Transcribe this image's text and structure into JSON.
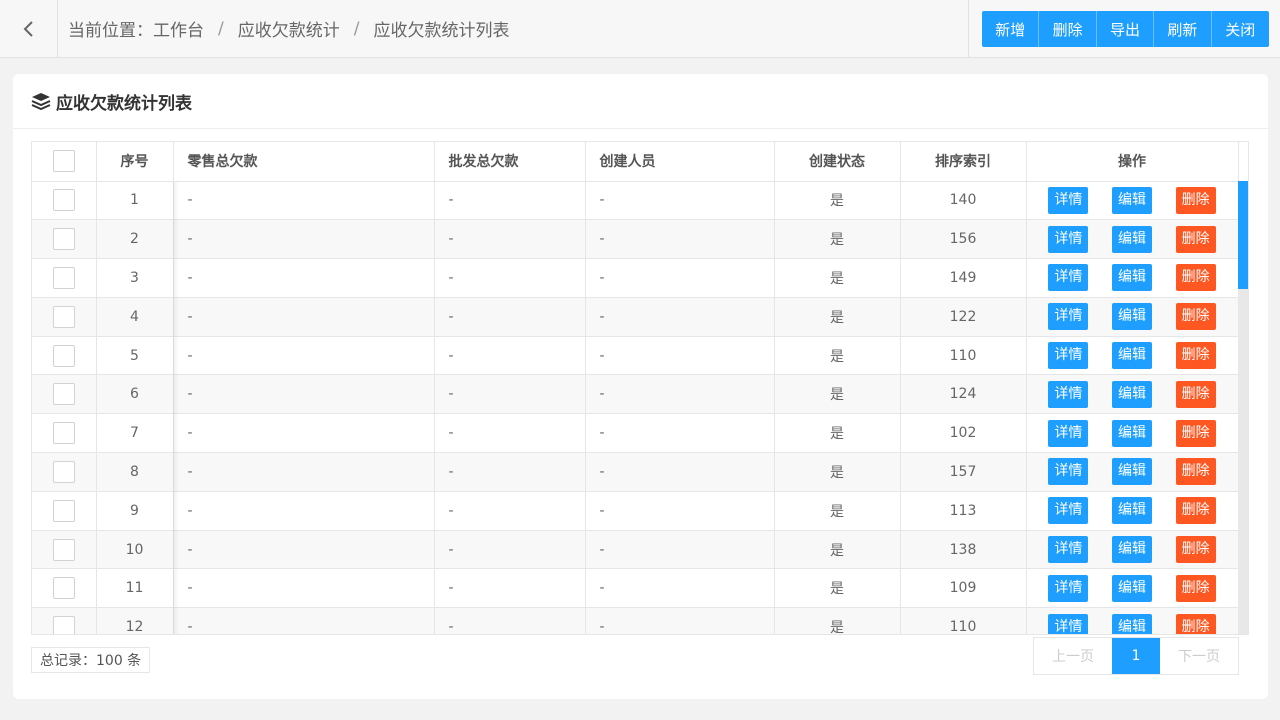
{
  "breadcrumb": {
    "prefix": "当前位置：",
    "items": [
      "工作台",
      "应收欠款统计",
      "应收欠款统计列表"
    ],
    "separator": "/"
  },
  "toolbar": {
    "add_label": "新增",
    "delete_label": "删除",
    "export_label": "导出",
    "refresh_label": "刷新",
    "close_label": "关闭"
  },
  "card": {
    "title": "应收欠款统计列表",
    "title_icon": "layers-icon"
  },
  "table": {
    "columns": [
      "序号",
      "零售总欠款",
      "批发总欠款",
      "创建人员",
      "创建状态",
      "排序索引",
      "操作"
    ],
    "actions": {
      "detail": "详情",
      "edit": "编辑",
      "delete": "删除"
    },
    "rows": [
      {
        "seq": "1",
        "retail": "-",
        "wholesale": "-",
        "creator": "-",
        "status": "是",
        "sort": "140"
      },
      {
        "seq": "2",
        "retail": "-",
        "wholesale": "-",
        "creator": "-",
        "status": "是",
        "sort": "156"
      },
      {
        "seq": "3",
        "retail": "-",
        "wholesale": "-",
        "creator": "-",
        "status": "是",
        "sort": "149"
      },
      {
        "seq": "4",
        "retail": "-",
        "wholesale": "-",
        "creator": "-",
        "status": "是",
        "sort": "122"
      },
      {
        "seq": "5",
        "retail": "-",
        "wholesale": "-",
        "creator": "-",
        "status": "是",
        "sort": "110"
      },
      {
        "seq": "6",
        "retail": "-",
        "wholesale": "-",
        "creator": "-",
        "status": "是",
        "sort": "124"
      },
      {
        "seq": "7",
        "retail": "-",
        "wholesale": "-",
        "creator": "-",
        "status": "是",
        "sort": "102"
      },
      {
        "seq": "8",
        "retail": "-",
        "wholesale": "-",
        "creator": "-",
        "status": "是",
        "sort": "157"
      },
      {
        "seq": "9",
        "retail": "-",
        "wholesale": "-",
        "creator": "-",
        "status": "是",
        "sort": "113"
      },
      {
        "seq": "10",
        "retail": "-",
        "wholesale": "-",
        "creator": "-",
        "status": "是",
        "sort": "138"
      },
      {
        "seq": "11",
        "retail": "-",
        "wholesale": "-",
        "creator": "-",
        "status": "是",
        "sort": "109"
      },
      {
        "seq": "12",
        "retail": "-",
        "wholesale": "-",
        "creator": "-",
        "status": "是",
        "sort": "110"
      }
    ]
  },
  "footer": {
    "total_text": "总记录：100 条",
    "prev_label": "上一页",
    "current_page": "1",
    "next_label": "下一页"
  },
  "colors": {
    "primary": "#1e9fff",
    "danger": "#ff5722",
    "page_bg": "#f2f2f2"
  }
}
